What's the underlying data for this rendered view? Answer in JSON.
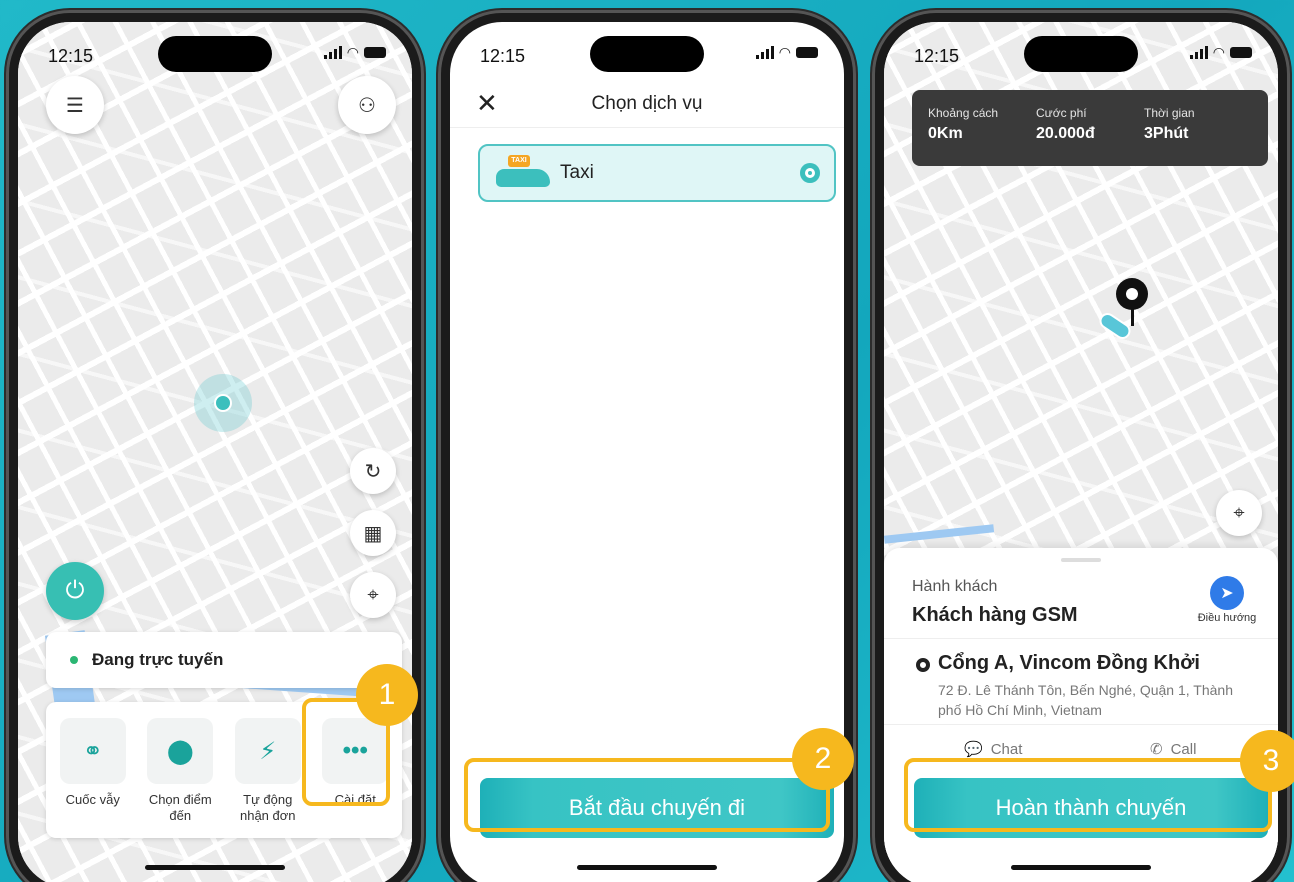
{
  "status": {
    "time": "12:15"
  },
  "screen1": {
    "online_status": "Đang trực tuyến",
    "actions": [
      {
        "label": "Cuốc vẫy",
        "icon": "users-icon"
      },
      {
        "label": "Chọn điểm đến",
        "icon": "location-pin-icon"
      },
      {
        "label": "Tự động nhận đơn",
        "icon": "lightning-icon"
      },
      {
        "label": "Cài đặt",
        "icon": "more-dots-icon"
      }
    ],
    "step": "1"
  },
  "screen2": {
    "title": "Chọn dịch vụ",
    "service": {
      "label": "Taxi",
      "badge": "TAXI"
    },
    "cta": "Bắt đầu chuyến đi",
    "step": "2"
  },
  "screen3": {
    "info": [
      {
        "label": "Khoảng cách",
        "value": "0Km"
      },
      {
        "label": "Cước phí",
        "value": "20.000đ"
      },
      {
        "label": "Thời gian",
        "value": "3Phút"
      }
    ],
    "passenger_label": "Hành khách",
    "passenger_name": "Khách hàng GSM",
    "navigate_label": "Điều hướng",
    "address_title": "Cổng A, Vincom Đồng Khởi",
    "address_detail": "72 Đ. Lê Thánh Tôn, Bến Nghé, Quận 1, Thành phố Hồ Chí Minh, Vietnam",
    "chat_label": "Chat",
    "call_label": "Call",
    "cta": "Hoàn thành chuyến",
    "step": "3"
  },
  "colors": {
    "accent": "#3cbfbd",
    "highlight": "#f6b81e",
    "navigate": "#2f7be8"
  }
}
